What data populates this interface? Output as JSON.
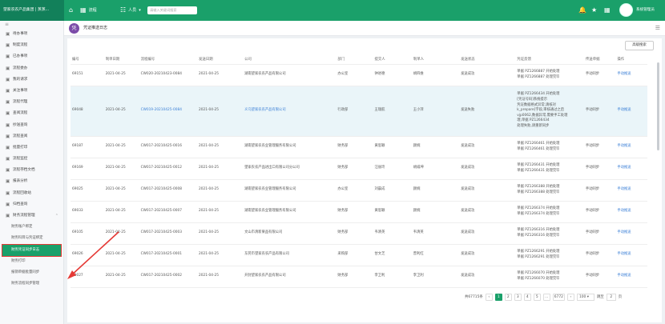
{
  "topbar": {
    "brand": "望家农农产品集团 | 蒸蒸...",
    "home_label": "",
    "flow_label": "流程",
    "people_label": "人员",
    "search_placeholder": "请输入关键词搜索",
    "username": "系统管理员"
  },
  "sidebar": {
    "collapse": "≡",
    "items": [
      {
        "label": "待办事项"
      },
      {
        "label": "制度流程"
      },
      {
        "label": "已办事项"
      },
      {
        "label": "流程委办"
      },
      {
        "label": "我的请求"
      },
      {
        "label": "关注事项"
      },
      {
        "label": "流程代理"
      },
      {
        "label": "查阅流程"
      },
      {
        "label": "抄送查询"
      },
      {
        "label": "流程查阅"
      },
      {
        "label": "批量打印"
      },
      {
        "label": "流程监控"
      },
      {
        "label": "流程存档文档"
      },
      {
        "label": "报表分析"
      },
      {
        "label": "流程回收站"
      },
      {
        "label": "归档查询"
      },
      {
        "label": "财务流程管理"
      }
    ],
    "subitems": [
      {
        "label": "财务账户绑定"
      },
      {
        "label": "财务科目与凭证绑定"
      },
      {
        "label": "财务凭证同步日志",
        "active": true
      },
      {
        "label": "财务打印"
      },
      {
        "label": "报销单据批量同步"
      },
      {
        "label": "财务流程同步管理"
      }
    ]
  },
  "tab": {
    "icon": "凭",
    "title": "凭证推送日志",
    "menu": "☰"
  },
  "toolbar": {
    "reset_label": "高级搜索"
  },
  "table": {
    "headers": [
      "编号",
      "制单日期",
      "流程编号",
      "发送日期",
      "公司",
      "部门",
      "提交人",
      "制单人",
      "发送状态",
      "凭证反馈",
      "传送单据",
      "操作"
    ],
    "rows": [
      {
        "id": "69151",
        "date": "2021-04-25",
        "flow": "CW020-20210423-0084",
        "send": "2021-04-25",
        "company": "湖南望家农农产品有限公司",
        "dept": "办公室",
        "submitter": "钟进德",
        "maker": "胡四维",
        "status": "发送成功",
        "feedback": "单据 PZ1266887 开始处理<br>单据 PZ1266887 处理完毕",
        "doc": "手动同步",
        "op": "手动推送",
        "link": false,
        "tall": false
      },
      {
        "id": "69048",
        "date": "2021-04-25",
        "flow": "CW019-20210425-0084",
        "send": "2021-04-25",
        "company": "义乌望家农农产品有限公司",
        "dept": "行政部",
        "submitter": "王瑞航",
        "maker": "王小萍",
        "status": "发送失败",
        "feedback": "单据 PZ1266434 开始处理<br>[凭证号码]系统提示<br>凭证数据格式异常,请核对<br>k_prepare]字段,审核通过之后<br>vjp0062,数据异常,需要手工处理<br>理,单据 PZ1266434<br>处理失败,请重新同步",
        "doc": "手动同步",
        "op": "手动推送",
        "link": true,
        "tall": true
      },
      {
        "id": "69187",
        "date": "2021-04-25",
        "flow": "CW017-20210425-0016",
        "send": "2021-04-25",
        "company": "湖南望家农农业管理服务有限公司",
        "dept": "财务部",
        "submitter": "黄思颖",
        "maker": "颜婉",
        "status": "发送成功",
        "feedback": "单据 PZ1266461 开始处理<br>单据 PZ1266461 处理完毕",
        "doc": "手动同步",
        "op": "手动推送",
        "link": false,
        "tall": false
      },
      {
        "id": "69169",
        "date": "2021-04-25",
        "flow": "CW017-20210425-0012",
        "send": "2021-04-25",
        "company": "望家农农产品进出口有限公司分公司",
        "dept": "财务部",
        "submitter": "汪丽玲",
        "maker": "胡威坤",
        "status": "发送成功",
        "feedback": "单据 PZ1266431 开始处理<br>单据 PZ1266431 处理完毕",
        "doc": "手动同步",
        "op": "手动推送",
        "link": false,
        "tall": false
      },
      {
        "id": "69025",
        "date": "2021-04-25",
        "flow": "CW017-20210425-0008",
        "send": "2021-04-25",
        "company": "湖南望家农农业管理服务有限公司",
        "dept": "办公室",
        "submitter": "刘晨成",
        "maker": "颜婉",
        "status": "发送成功",
        "feedback": "单据 PZ1266388 开始处理<br>单据 PZ1266388 处理完毕",
        "doc": "手动同步",
        "op": "手动推送",
        "link": false,
        "tall": false
      },
      {
        "id": "69033",
        "date": "2021-04-25",
        "flow": "CW017-20210425-0007",
        "send": "2021-04-25",
        "company": "湖南望家农农业管理服务有限公司",
        "dept": "财务部",
        "submitter": "黄思颖",
        "maker": "颜婉",
        "status": "发送成功",
        "feedback": "单据 PZ1266374 开始处理<br>单据 PZ1266374 处理完毕",
        "doc": "手动同步",
        "op": "手动推送",
        "link": false,
        "tall": false
      },
      {
        "id": "69105",
        "date": "2021-04-25",
        "flow": "CW017-20210425-0003",
        "send": "2021-04-25",
        "company": "文山市清新果品有限公司",
        "dept": "财务部",
        "submitter": "韦清英",
        "maker": "韦清英",
        "status": "发送成功",
        "feedback": "单据 PZ1266316 开始处理<br>单据 PZ1266316 处理完毕",
        "doc": "手动同步",
        "op": "手动推送",
        "link": false,
        "tall": false
      },
      {
        "id": "69026",
        "date": "2021-04-25",
        "flow": "CW017-20210425-0001",
        "send": "2021-04-25",
        "company": "东莞市望家农农产品有限公司",
        "dept": "采购部",
        "submitter": "甘文芝",
        "maker": "曾利红",
        "status": "发送成功",
        "feedback": "单据 PZ1266291 开始处理<br>单据 PZ1266291 处理完毕",
        "doc": "手动同步",
        "op": "手动推送",
        "link": false,
        "tall": false
      },
      {
        "id": "69027",
        "date": "2021-04-25",
        "flow": "CW017-20210425-0002",
        "send": "2021-04-25",
        "company": "开封望家农农产品有限公司",
        "dept": "财务部",
        "submitter": "李卫利",
        "maker": "李卫利",
        "status": "发送成功",
        "feedback": "单据 PZ1266070 开始处理<br>单据 PZ1266070 处理完毕",
        "doc": "手动同步",
        "op": "手动推送",
        "link": false,
        "tall": false
      }
    ]
  },
  "pager": {
    "total": "共67715条",
    "pages": [
      "1",
      "2",
      "3",
      "4",
      "5",
      "...",
      "6772"
    ],
    "active": "1",
    "size": "100 ▾",
    "jump_label": "跳至",
    "jump_value": "2",
    "page_unit": "页"
  },
  "colors": {
    "brand": "#1aa06a",
    "link": "#3a7fd6",
    "annotation": "#e53935"
  }
}
